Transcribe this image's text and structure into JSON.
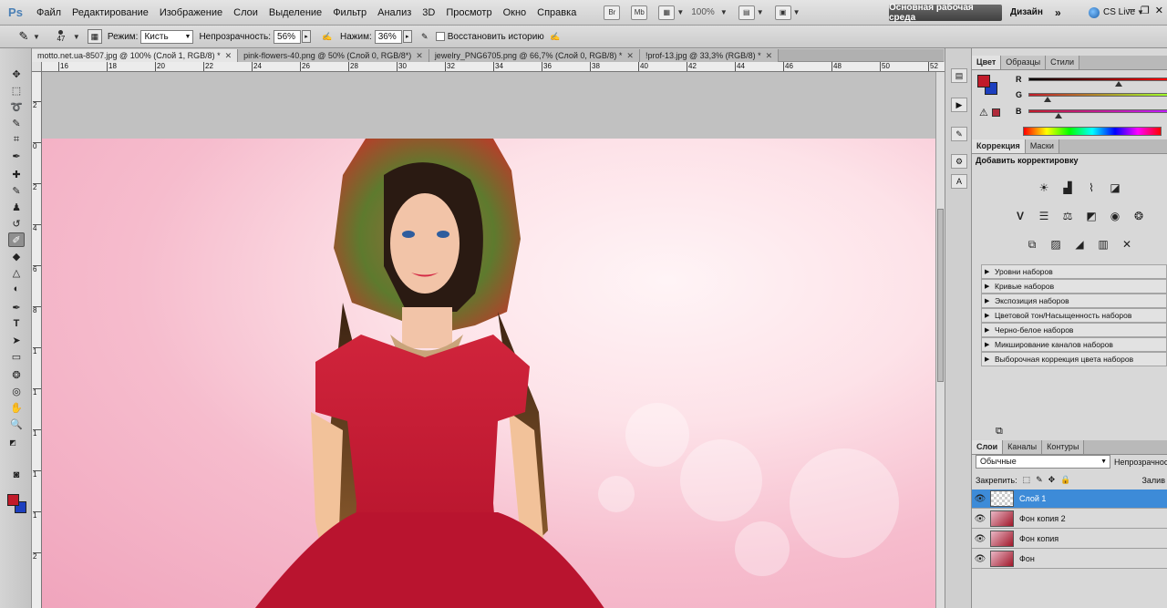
{
  "app": {
    "logo": "Ps"
  },
  "menu": [
    "Файл",
    "Редактирование",
    "Изображение",
    "Слои",
    "Выделение",
    "Фильтр",
    "Анализ",
    "3D",
    "Просмотр",
    "Окно",
    "Справка"
  ],
  "toolbar_top": {
    "bridge": "Br",
    "mini": "Mb",
    "zoom": "100%",
    "workspace": "Основная рабочая среда",
    "design": "Дизайн",
    "more": "»",
    "cslive": "CS Live"
  },
  "options": {
    "brush_size": "47",
    "mode_label": "Режим:",
    "mode_value": "Кисть",
    "opacity_label": "Непрозрачность:",
    "opacity_value": "56%",
    "pressure_label": "Нажим:",
    "pressure_value": "36%",
    "restore_label": "Восстановить историю"
  },
  "tabs": [
    {
      "label": "motto.net.ua-8507.jpg @ 100% (Слой 1, RGB/8) *"
    },
    {
      "label": "pink-flowers-40.png @ 50% (Слой 0, RGB/8*)"
    },
    {
      "label": "jewelry_PNG6705.png @ 66,7% (Слой 0, RGB/8) *"
    },
    {
      "label": "!prof-13.jpg @ 33,3% (RGB/8) *"
    }
  ],
  "ruler_top": [
    "16",
    "18",
    "20",
    "22",
    "24",
    "26",
    "28",
    "30",
    "32",
    "34",
    "36",
    "38",
    "40",
    "42",
    "44",
    "46",
    "48",
    "50",
    "52"
  ],
  "ruler_left": [
    "2",
    "0",
    "2",
    "4",
    "6",
    "8",
    "1",
    "1",
    "1",
    "1",
    "1",
    "2"
  ],
  "colors": {
    "foreground": "#c11b2a",
    "background": "#1c3fbf",
    "accent": "#3d8bd8"
  },
  "color_panel": {
    "tabs": [
      "Цвет",
      "Образцы",
      "Стили"
    ],
    "r_label": "R",
    "g_label": "G",
    "b_label": "B"
  },
  "adjust_panel": {
    "tabs": [
      "Коррекция",
      "Маски"
    ],
    "title": "Добавить корректировку",
    "presets": [
      "Уровни наборов",
      "Кривые наборов",
      "Экспозиция наборов",
      "Цветовой тон/Насыщенность наборов",
      "Черно-белое наборов",
      "Микширование каналов наборов",
      "Выборочная коррекция цвета наборов"
    ]
  },
  "layers_panel": {
    "tabs": [
      "Слои",
      "Каналы",
      "Контуры"
    ],
    "blend_mode": "Обычные",
    "opacity_label": "Непрозрачност",
    "lock_label": "Закрепить:",
    "fill_label": "Залив",
    "layers": [
      {
        "name": "Слой 1"
      },
      {
        "name": "Фон копия 2"
      },
      {
        "name": "Фон копия"
      },
      {
        "name": "Фон"
      }
    ]
  }
}
